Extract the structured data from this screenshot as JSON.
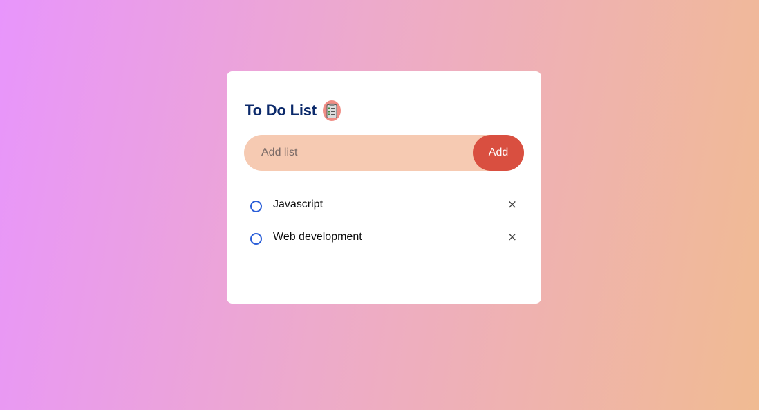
{
  "header": {
    "title": "To Do List",
    "icon": "clipboard-checklist-icon"
  },
  "input": {
    "placeholder": "Add list",
    "value": "",
    "add_label": "Add"
  },
  "list": {
    "items": [
      {
        "label": "Javascript",
        "checked": false
      },
      {
        "label": "Web development",
        "checked": false
      }
    ],
    "delete_glyph": "×"
  },
  "colors": {
    "title": "#0c2a6b",
    "input_bg": "#f6cab2",
    "add_button": "#d94f40",
    "circle": "#2a5ed8",
    "bg_start": "#e895fc",
    "bg_end": "#f0bb92"
  }
}
